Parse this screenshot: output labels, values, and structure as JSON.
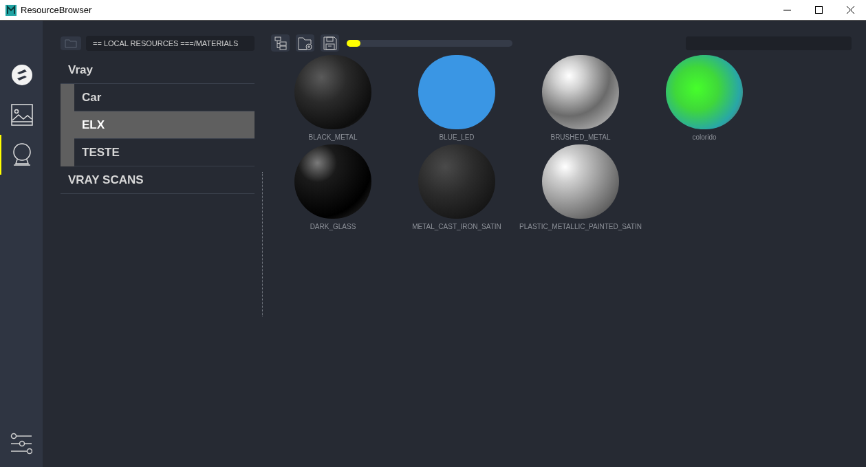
{
  "window": {
    "title": "ResourceBrowser"
  },
  "nav": [
    {
      "kind": "logo",
      "selected": false
    },
    {
      "kind": "image",
      "selected": false
    },
    {
      "kind": "sphere",
      "selected": true
    }
  ],
  "path": {
    "text": "== LOCAL RESOURCES ===/MATERIALS"
  },
  "tree": [
    {
      "label": "Vray",
      "selected": false,
      "children": [
        {
          "label": "Car",
          "selected": false
        },
        {
          "label": "ELX",
          "selected": true
        },
        {
          "label": "TESTE",
          "selected": false
        }
      ]
    },
    {
      "label": "VRAY SCANS",
      "selected": false
    }
  ],
  "progress": {
    "level": 0.06
  },
  "materials": [
    {
      "name": "BLACK_METAL",
      "kind": "dark_metal"
    },
    {
      "name": "BLUE_LED",
      "kind": "flat"
    },
    {
      "name": "BRUSHED_METAL",
      "kind": "chrome"
    },
    {
      "name": "colorido",
      "kind": "rainbow"
    },
    {
      "name": "DARK_GLASS",
      "kind": "glass"
    },
    {
      "name": "METAL_CAST_IRON_SATIN",
      "kind": "satin"
    },
    {
      "name": "PLASTIC_METALLIC_PAINTED_SATIN",
      "kind": "silver"
    }
  ]
}
